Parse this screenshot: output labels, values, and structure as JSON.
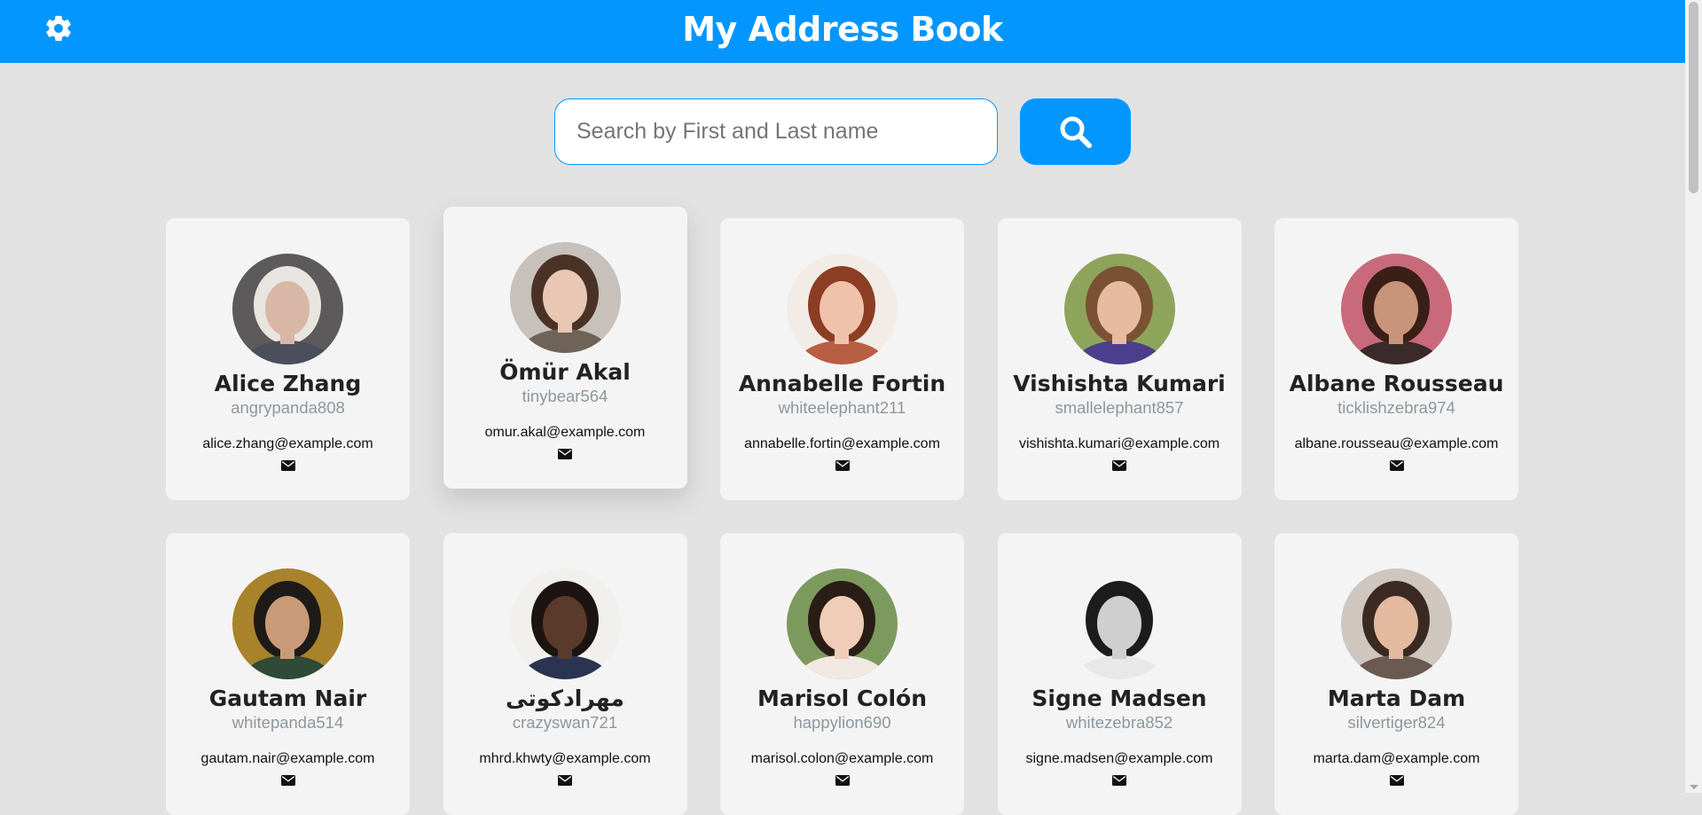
{
  "header": {
    "title": "My Address Book",
    "settings_icon": "gear-icon",
    "background": "#0396ff"
  },
  "search": {
    "placeholder": "Search by First and Last name",
    "value": "",
    "button_icon": "search-icon"
  },
  "contacts": [
    {
      "name": "Alice Zhang",
      "username": "angrypanda808",
      "email": "alice.zhang@example.com",
      "avatar": {
        "bg": "#5c5a5a",
        "hair": "#e8e4df",
        "skin": "#d9b7a6",
        "shirt": "#4b4f5c"
      }
    },
    {
      "name": "Ömür Akal",
      "username": "tinybear564",
      "email": "omur.akal@example.com",
      "avatar": {
        "bg": "#c7c0bb",
        "hair": "#4a3226",
        "skin": "#e8c7b4",
        "shirt": "#6f6358"
      }
    },
    {
      "name": "Annabelle Fortin",
      "username": "whiteelephant211",
      "email": "annabelle.fortin@example.com",
      "avatar": {
        "bg": "#f3ebe6",
        "hair": "#8c3d24",
        "skin": "#f0c2ab",
        "shirt": "#b85e43"
      }
    },
    {
      "name": "Vishishta Kumari",
      "username": "smallelephant857",
      "email": "vishishta.kumari@example.com",
      "avatar": {
        "bg": "#8fa45b",
        "hair": "#7a5233",
        "skin": "#e6bba0",
        "shirt": "#4c3e8c"
      }
    },
    {
      "name": "Albane Rousseau",
      "username": "ticklishzebra974",
      "email": "albane.rousseau@example.com",
      "avatar": {
        "bg": "#c96a7b",
        "hair": "#3a1f16",
        "skin": "#c9957a",
        "shirt": "#3a2a2a"
      }
    },
    {
      "name": "Gautam Nair",
      "username": "whitepanda514",
      "email": "gautam.nair@example.com",
      "avatar": {
        "bg": "#a9822c",
        "hair": "#1e1a17",
        "skin": "#c99a78",
        "shirt": "#2f4a36"
      }
    },
    {
      "name": "مهرادکوتی",
      "username": "crazyswan721",
      "email": "mhrd.khwty@example.com",
      "avatar": {
        "bg": "#f2f0ed",
        "hair": "#1c1410",
        "skin": "#5a3a2a",
        "shirt": "#2a3450"
      }
    },
    {
      "name": "Marisol Colón",
      "username": "happylion690",
      "email": "marisol.colon@example.com",
      "avatar": {
        "bg": "#7d9a5e",
        "hair": "#2a1d16",
        "skin": "#efcdb8",
        "shirt": "#f2e8e2"
      }
    },
    {
      "name": "Signe Madsen",
      "username": "whitezebra852",
      "email": "signe.madsen@example.com",
      "avatar": {
        "bg": "#f4f4f4",
        "hair": "#1c1c1c",
        "skin": "#cfcfcf",
        "shirt": "#e8e8e8"
      }
    },
    {
      "name": "Marta Dam",
      "username": "silvertiger824",
      "email": "marta.dam@example.com",
      "avatar": {
        "bg": "#cfc7bf",
        "hair": "#3a2a22",
        "skin": "#e3b9a0",
        "shirt": "#6b5a50"
      }
    }
  ],
  "hovered_index": 1,
  "mail_icon": "mail-icon"
}
